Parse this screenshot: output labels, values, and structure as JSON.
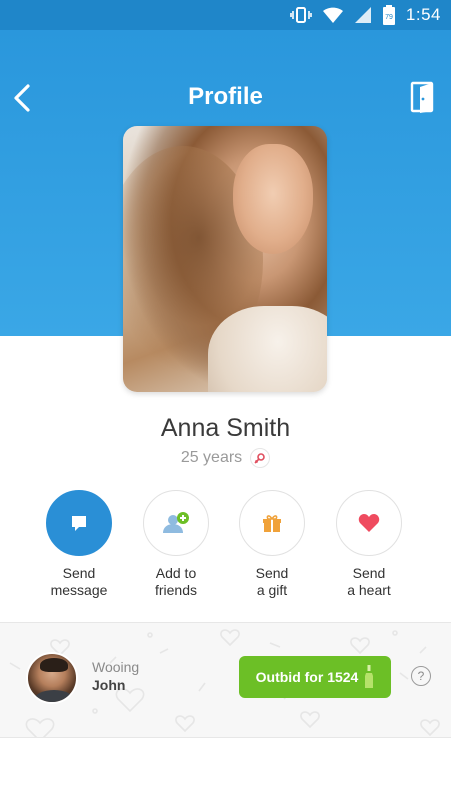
{
  "status_bar": {
    "time": "1:54",
    "battery_level": "79"
  },
  "header": {
    "title": "Profile"
  },
  "profile": {
    "name": "Anna Smith",
    "age": "25 years"
  },
  "actions": [
    {
      "label_line1": "Send",
      "label_line2": "message"
    },
    {
      "label_line1": "Add to",
      "label_line2": "friends"
    },
    {
      "label_line1": "Send",
      "label_line2": "a gift"
    },
    {
      "label_line1": "Send",
      "label_line2": "a heart"
    }
  ],
  "bid": {
    "wooing_label": "Wooing",
    "wooer_name": "John",
    "outbid_label": "Outbid for 1524",
    "help": "?"
  },
  "colors": {
    "brand_blue": "#2a97dc",
    "accent_green": "#6cbf26",
    "heart_red": "#ef4b5f",
    "gift_orange": "#f0a23a"
  }
}
